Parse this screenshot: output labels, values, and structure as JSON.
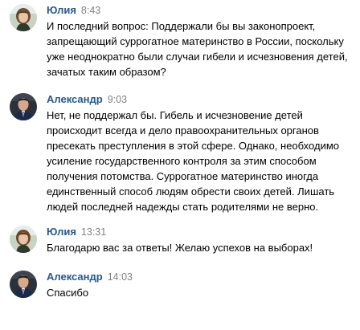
{
  "colors": {
    "author_link": "#2a5885",
    "timestamp": "#828282",
    "text": "#000000",
    "background": "#ffffff"
  },
  "messages": [
    {
      "author": "Юлия",
      "time": "8:43",
      "avatar_icon": "user-photo-yulia",
      "lines": [
        "И последний вопрос: Поддержали бы вы законопроект,",
        "запрещающий суррогатное материнство в России, поскольку",
        "уже неоднократно были случаи гибели и исчезновения детей,",
        "зачатых таким образом?"
      ]
    },
    {
      "author": "Александр",
      "time": "9:03",
      "avatar_icon": "user-photo-alexander",
      "lines": [
        "Нет, не поддержал бы. Гибель и исчезновение детей",
        "происходит всегда и дело правоохранительных органов",
        "пресекать преступления в этой сфере. Однако, необходимо",
        "усиление государственного контроля за этим способом",
        "получения потомства. Суррогатное материнство иногда",
        "единственный способ людям обрести своих детей. Лишать",
        "людей последней надежды стать родителями не верно."
      ]
    },
    {
      "author": "Юлия",
      "time": "13:31",
      "avatar_icon": "user-photo-yulia",
      "lines": [
        "Благодарю вас за ответы! Желаю успехов на выборах!"
      ]
    },
    {
      "author": "Александр",
      "time": "14:03",
      "avatar_icon": "user-photo-alexander",
      "lines": [
        "Спасибо"
      ]
    }
  ]
}
